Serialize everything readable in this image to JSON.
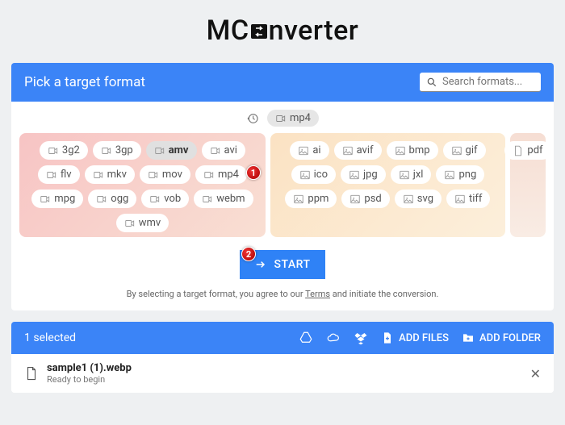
{
  "logo_pre": "MC",
  "logo_post": "nverter",
  "header": {
    "title": "Pick a target format",
    "search_placeholder": "Search formats..."
  },
  "recent": {
    "format": "mp4"
  },
  "video": [
    "3g2",
    "3gp",
    "amv",
    "avi",
    "flv",
    "mkv",
    "mov",
    "mp4",
    "mpg",
    "ogg",
    "vob",
    "webm",
    "wmv"
  ],
  "image": [
    "ai",
    "avif",
    "bmp",
    "gif",
    "ico",
    "jpg",
    "jxl",
    "png",
    "ppm",
    "psd",
    "svg",
    "tiff"
  ],
  "doc": [
    "pdf"
  ],
  "selected_format": "amv",
  "callouts": {
    "one": "1",
    "two": "2"
  },
  "start": "START",
  "terms_pre": "By selecting a target format, you agree to our ",
  "terms_link": "Terms",
  "terms_post": " and initiate the conversion.",
  "bar": {
    "selected": "1 selected",
    "add_files": "ADD FILES",
    "add_folder": "ADD FOLDER"
  },
  "file": {
    "name": "sample1 (1).webp",
    "status": "Ready to begin"
  }
}
